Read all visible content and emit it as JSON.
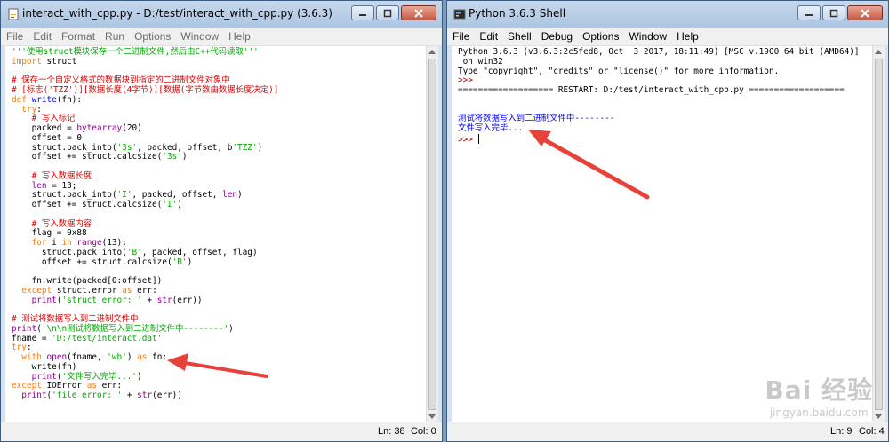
{
  "editor_window": {
    "title": "interact_with_cpp.py - D:/test/interact_with_cpp.py (3.6.3)",
    "menu": [
      "File",
      "Edit",
      "Format",
      "Run",
      "Options",
      "Window",
      "Help"
    ],
    "status_ln": "Ln: 38",
    "status_col": "Col: 0"
  },
  "shell_window": {
    "title": "Python 3.6.3 Shell",
    "menu": [
      "File",
      "Edit",
      "Shell",
      "Debug",
      "Options",
      "Window",
      "Help"
    ],
    "status_ln": "Ln: 9",
    "status_col": "Col: 4"
  },
  "editor_code": [
    [
      [
        "'''使用struct模块保存一个二进制文件,然后由C++代码读取'''",
        "st"
      ]
    ],
    [
      [
        "import",
        "kw"
      ],
      [
        " struct",
        ""
      ]
    ],
    [
      [
        "",
        ""
      ]
    ],
    [
      [
        "# 保存一个自定义格式的数据块到指定的二进制文件对象中",
        "cm"
      ]
    ],
    [
      [
        "# [标志('TZZ')][数据长度(4字节)][数据(字节数由数据长度决定)]",
        "cm"
      ]
    ],
    [
      [
        "def",
        "kw"
      ],
      [
        " ",
        ""
      ],
      [
        "write",
        "fn"
      ],
      [
        "(fn):",
        ""
      ]
    ],
    [
      [
        "  ",
        ""
      ],
      [
        "try",
        "kw"
      ],
      [
        ":",
        ""
      ]
    ],
    [
      [
        "    ",
        ""
      ],
      [
        "# 写入标记",
        "cm"
      ]
    ],
    [
      [
        "    packed = ",
        ""
      ],
      [
        "bytearray",
        "bi"
      ],
      [
        "(20)",
        ""
      ]
    ],
    [
      [
        "    offset = 0",
        ""
      ]
    ],
    [
      [
        "    struct.pack_into(",
        ""
      ],
      [
        "'3s'",
        "st"
      ],
      [
        ", packed, offset, b",
        ""
      ],
      [
        "'TZZ'",
        "st"
      ],
      [
        ")",
        ""
      ]
    ],
    [
      [
        "    offset += struct.calcsize(",
        ""
      ],
      [
        "'3s'",
        "st"
      ],
      [
        ")",
        ""
      ]
    ],
    [
      [
        "",
        ""
      ]
    ],
    [
      [
        "    ",
        ""
      ],
      [
        "# 写入数据长度",
        "cm"
      ]
    ],
    [
      [
        "    ",
        ""
      ],
      [
        "len",
        "bi"
      ],
      [
        " = 13;",
        ""
      ]
    ],
    [
      [
        "    struct.pack_into(",
        ""
      ],
      [
        "'I'",
        "st"
      ],
      [
        ", packed, offset, ",
        ""
      ],
      [
        "len",
        "bi"
      ],
      [
        ")",
        ""
      ]
    ],
    [
      [
        "    offset += struct.calcsize(",
        ""
      ],
      [
        "'I'",
        "st"
      ],
      [
        ")",
        ""
      ]
    ],
    [
      [
        "",
        ""
      ]
    ],
    [
      [
        "    ",
        ""
      ],
      [
        "# 写入数据内容",
        "cm"
      ]
    ],
    [
      [
        "    flag = 0x88",
        ""
      ]
    ],
    [
      [
        "    ",
        ""
      ],
      [
        "for",
        "kw"
      ],
      [
        " i ",
        ""
      ],
      [
        "in",
        "kw"
      ],
      [
        " ",
        ""
      ],
      [
        "range",
        "bi"
      ],
      [
        "(13):",
        ""
      ]
    ],
    [
      [
        "      struct.pack_into(",
        ""
      ],
      [
        "'B'",
        "st"
      ],
      [
        ", packed, offset, flag)",
        ""
      ]
    ],
    [
      [
        "      offset += struct.calcsize(",
        ""
      ],
      [
        "'B'",
        "st"
      ],
      [
        ")",
        ""
      ]
    ],
    [
      [
        "",
        ""
      ]
    ],
    [
      [
        "    fn.write(packed[0:offset])",
        ""
      ]
    ],
    [
      [
        "  ",
        ""
      ],
      [
        "except",
        "kw"
      ],
      [
        " struct.error ",
        ""
      ],
      [
        "as",
        "kw"
      ],
      [
        " err:",
        ""
      ]
    ],
    [
      [
        "    ",
        ""
      ],
      [
        "print",
        "bi"
      ],
      [
        "(",
        ""
      ],
      [
        "'struct error: '",
        "st"
      ],
      [
        " + ",
        ""
      ],
      [
        "str",
        "bi"
      ],
      [
        "(err))",
        ""
      ]
    ],
    [
      [
        "",
        ""
      ]
    ],
    [
      [
        "# 测试将数据写入到二进制文件中",
        "cm"
      ]
    ],
    [
      [
        "print",
        "bi"
      ],
      [
        "(",
        ""
      ],
      [
        "'\\n\\n测试将数据写入到二进制文件中--------'",
        "st"
      ],
      [
        ")",
        ""
      ]
    ],
    [
      [
        "fname = ",
        ""
      ],
      [
        "'D:/test/interact.dat'",
        "st"
      ]
    ],
    [
      [
        "try",
        "kw"
      ],
      [
        ":",
        ""
      ]
    ],
    [
      [
        "  ",
        ""
      ],
      [
        "with",
        "kw"
      ],
      [
        " ",
        ""
      ],
      [
        "open",
        "bi"
      ],
      [
        "(fname, ",
        ""
      ],
      [
        "'wb'",
        "st"
      ],
      [
        ") ",
        ""
      ],
      [
        "as",
        "kw"
      ],
      [
        " fn:",
        ""
      ]
    ],
    [
      [
        "    write(fn)",
        ""
      ]
    ],
    [
      [
        "    ",
        ""
      ],
      [
        "print",
        "bi"
      ],
      [
        "(",
        ""
      ],
      [
        "'文件写入完毕...'",
        "st"
      ],
      [
        ")",
        ""
      ]
    ],
    [
      [
        "except",
        "kw"
      ],
      [
        " IOError ",
        ""
      ],
      [
        "as",
        "kw"
      ],
      [
        " err:",
        ""
      ]
    ],
    [
      [
        "  ",
        ""
      ],
      [
        "print",
        "bi"
      ],
      [
        "(",
        ""
      ],
      [
        "'file error: '",
        "st"
      ],
      [
        " + ",
        ""
      ],
      [
        "str",
        "bi"
      ],
      [
        "(err))",
        ""
      ]
    ]
  ],
  "shell_lines": [
    [
      [
        "Python 3.6.3 (v3.6.3:2c5fed8, Oct  3 2017, 18:11:49) [MSC v.1900 64 bit (AMD64)]",
        ""
      ]
    ],
    [
      [
        " on win32",
        ""
      ]
    ],
    [
      [
        "Type \"copyright\", \"credits\" or \"license()\" for more information.",
        ""
      ]
    ],
    [
      [
        ">>> ",
        "pr"
      ]
    ],
    [
      [
        "=================== RESTART: D:/test/interact_with_cpp.py ===================",
        ""
      ]
    ],
    [
      [
        "",
        ""
      ]
    ],
    [
      [
        "",
        ""
      ]
    ],
    [
      [
        "测试将数据写入到二进制文件中--------",
        "out"
      ]
    ],
    [
      [
        "文件写入完毕...",
        "out"
      ]
    ]
  ],
  "shell_prompt": ">>> ",
  "watermark": {
    "brand": "Bai 经验",
    "url": "jingyan.baidu.com"
  },
  "colors": {
    "comment": "#dd0000",
    "keyword": "#ff7700",
    "string": "#00aa00",
    "builtin": "#900090",
    "output": "#0000ff",
    "arrow": "#e8413a"
  }
}
